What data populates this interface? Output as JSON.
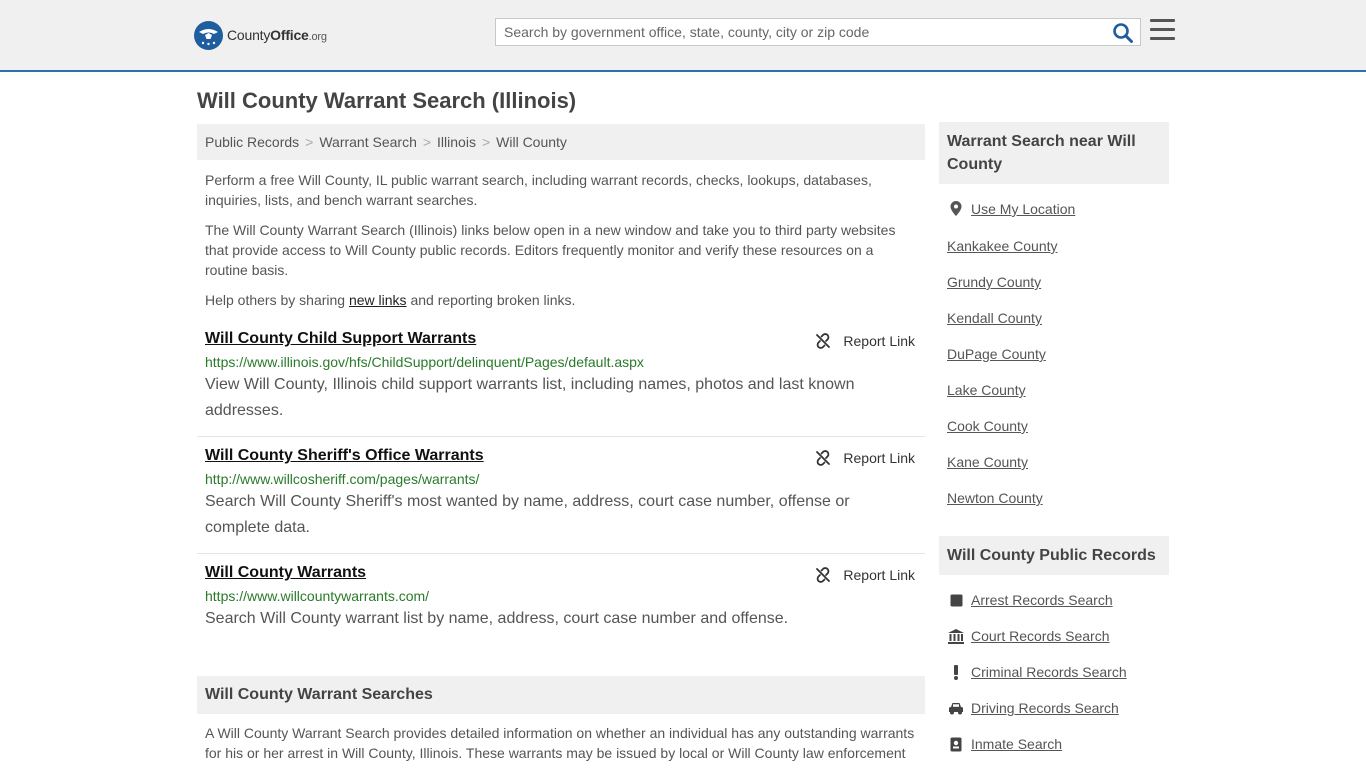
{
  "header": {
    "logo_county": "County",
    "logo_office": "Office",
    "logo_org": ".org",
    "search_placeholder": "Search by government office, state, county, city or zip code"
  },
  "page": {
    "title": "Will County Warrant Search (Illinois)"
  },
  "breadcrumb": [
    "Public Records",
    "Warrant Search",
    "Illinois",
    "Will County"
  ],
  "intro": {
    "p1": "Perform a free Will County, IL public warrant search, including warrant records, checks, lookups, databases, inquiries, lists, and bench warrant searches.",
    "p2": "The Will County Warrant Search (Illinois) links below open in a new window and take you to third party websites that provide access to Will County public records. Editors frequently monitor and verify these resources on a routine basis.",
    "p3_before": "Help others by sharing ",
    "p3_link": "new links",
    "p3_after": " and reporting broken links."
  },
  "report_label": "Report Link",
  "entries": [
    {
      "title": "Will County Child Support Warrants",
      "url": "https://www.illinois.gov/hfs/ChildSupport/delinquent/Pages/default.aspx",
      "desc": "View Will County, Illinois child support warrants list, including names, photos and last known addresses."
    },
    {
      "title": "Will County Sheriff's Office Warrants",
      "url": "http://www.willcosheriff.com/pages/warrants/",
      "desc": "Search Will County Sheriff's most wanted by name, address, court case number, offense or complete data."
    },
    {
      "title": "Will County Warrants",
      "url": "https://www.willcountywarrants.com/",
      "desc": "Search Will County warrant list by name, address, court case number and offense."
    }
  ],
  "searches_section": {
    "heading": "Will County Warrant Searches",
    "text": "A Will County Warrant Search provides detailed information on whether an individual has any outstanding warrants for his or her arrest in Will County, Illinois. These warrants may be issued by local or Will County law enforcement"
  },
  "sidebar": {
    "nearby_heading": "Warrant Search near Will County",
    "use_location": "Use My Location",
    "nearby": [
      "Kankakee County",
      "Grundy County",
      "Kendall County",
      "DuPage County",
      "Lake County",
      "Cook County",
      "Kane County",
      "Newton County"
    ],
    "records_heading": "Will County Public Records",
    "records": [
      {
        "label": "Arrest Records Search",
        "icon": "square-icon"
      },
      {
        "label": "Court Records Search",
        "icon": "courthouse-icon"
      },
      {
        "label": "Criminal Records Search",
        "icon": "exclamation-icon"
      },
      {
        "label": "Driving Records Search",
        "icon": "car-icon"
      },
      {
        "label": "Inmate Search",
        "icon": "id-badge-icon"
      }
    ]
  },
  "colors": {
    "accent": "#2c6fb3",
    "url_green": "#2a7a2a",
    "panel": "#f0f0f0"
  }
}
